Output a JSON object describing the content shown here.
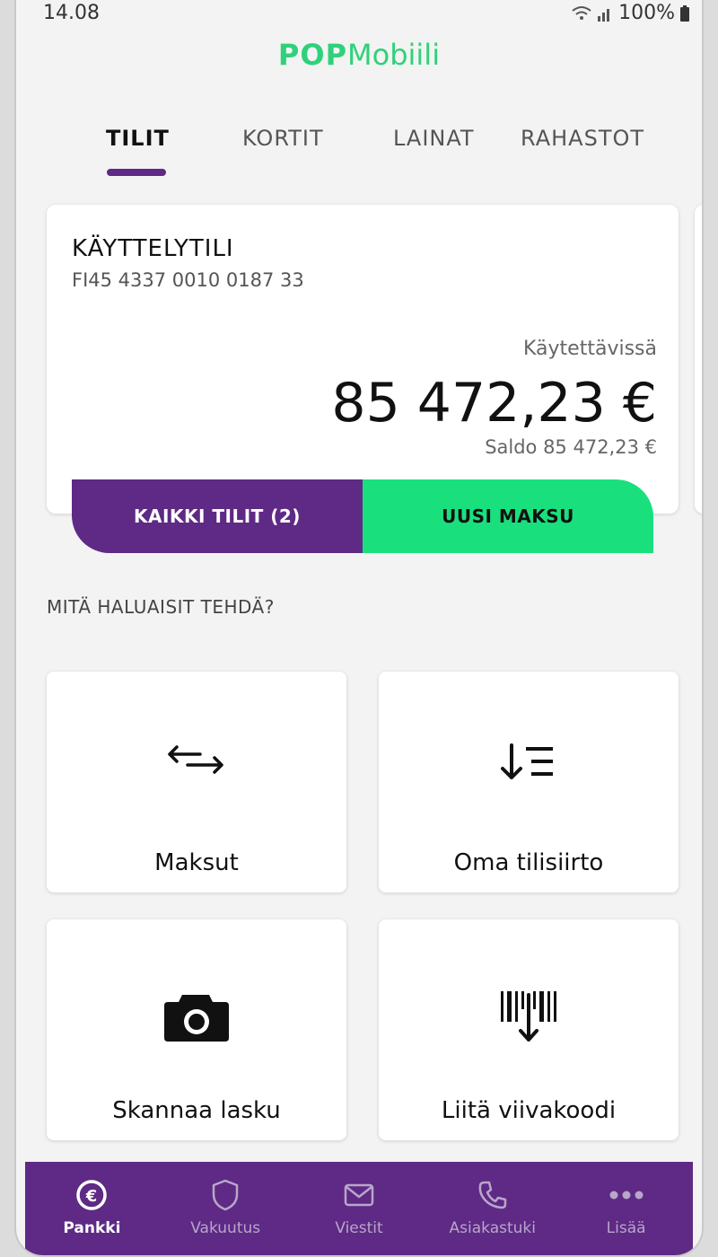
{
  "status_bar": {
    "time": "14.08",
    "battery": "100%"
  },
  "app": {
    "title_bold": "POP",
    "title_rest": "Mobiili"
  },
  "tabs": [
    {
      "label": "TILIT",
      "active": true
    },
    {
      "label": "KORTIT",
      "active": false
    },
    {
      "label": "LAINAT",
      "active": false
    },
    {
      "label": "RAHASTOT",
      "active": false
    }
  ],
  "account": {
    "name": "KÄYTTELYTILI",
    "iban": "FI45 4337 0010 0187 33",
    "available_label": "Käytettävissä",
    "available_amount": "85 472,23 €",
    "balance_text": "Saldo 85 472,23 €"
  },
  "actions": {
    "all_accounts": "KAIKKI TILIT (2)",
    "new_payment": "UUSI MAKSU"
  },
  "section": {
    "prompt": "MITÄ HALUAISIT TEHDÄ?"
  },
  "tiles": [
    {
      "label": "Maksut",
      "icon": "transfer-arrows-icon"
    },
    {
      "label": "Oma tilisiirto",
      "icon": "own-transfer-icon"
    },
    {
      "label": "Skannaa lasku",
      "icon": "camera-icon"
    },
    {
      "label": "Liitä viivakoodi",
      "icon": "barcode-icon"
    }
  ],
  "bottom_nav": [
    {
      "label": "Pankki",
      "icon": "euro-coin-icon",
      "active": true
    },
    {
      "label": "Vakuutus",
      "icon": "shield-icon",
      "active": false
    },
    {
      "label": "Viestit",
      "icon": "mail-icon",
      "active": false
    },
    {
      "label": "Asiakastuki",
      "icon": "phone-icon",
      "active": false
    },
    {
      "label": "Lisää",
      "icon": "more-dots-icon",
      "active": false
    }
  ],
  "colors": {
    "brand_purple": "#5e2a85",
    "brand_green": "#19e07d",
    "logo_green": "#2fd17a"
  }
}
